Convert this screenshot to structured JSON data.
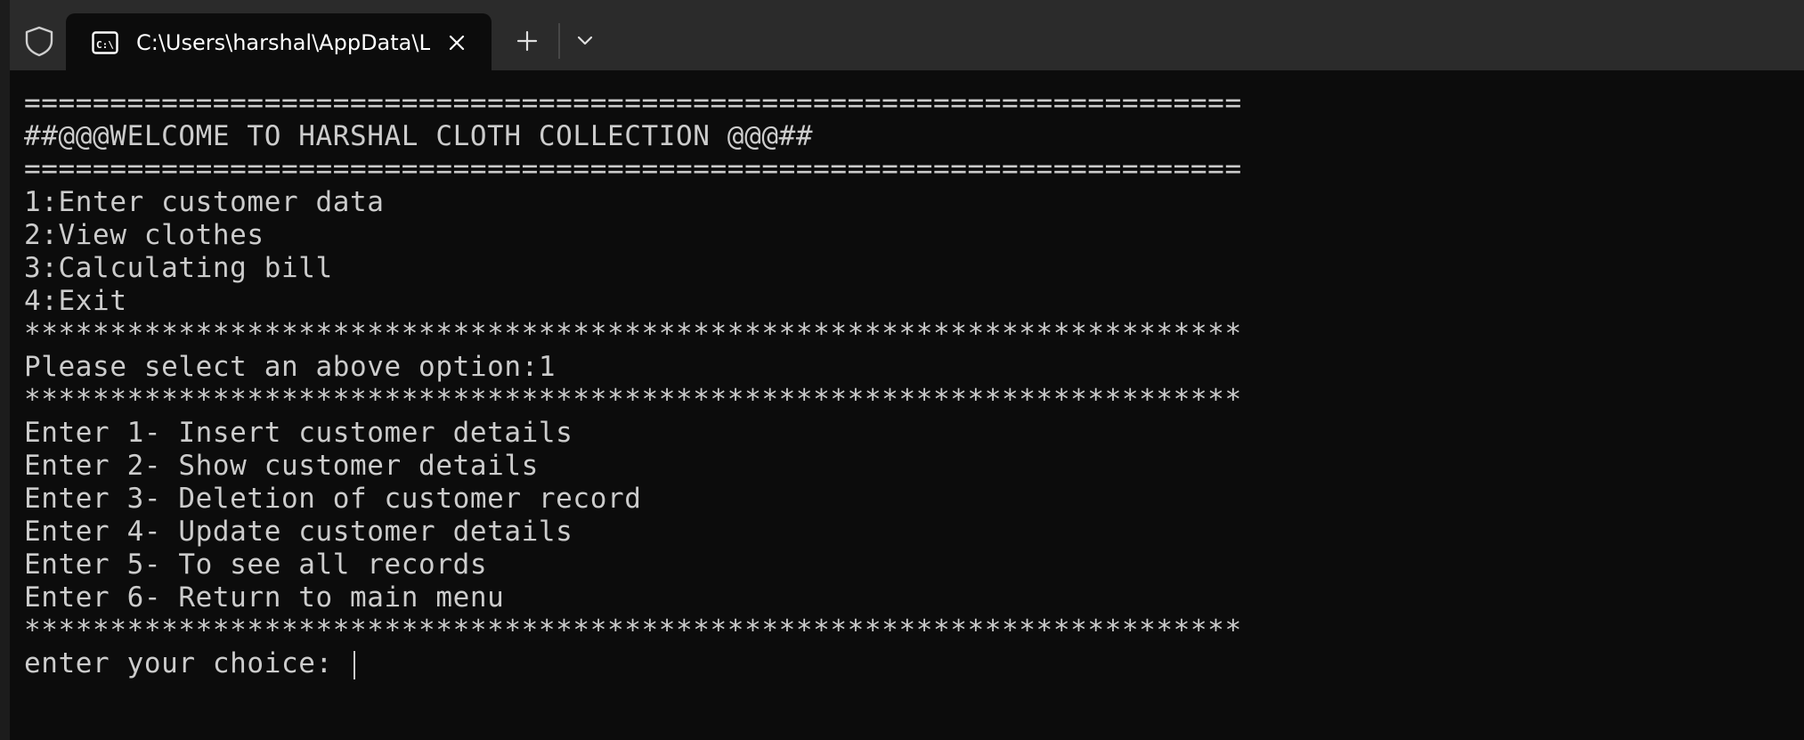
{
  "window": {
    "tab_title": "C:\\Users\\harshal\\AppData\\Local\\Temp\\",
    "icons": {
      "shield": "shield-icon",
      "tab": "command-prompt-icon",
      "close": "close-icon",
      "new_tab": "plus-icon",
      "dropdown": "chevron-down-icon"
    }
  },
  "terminal": {
    "lines": [
      "=======================================================================",
      "##@@@WELCOME TO HARSHAL CLOTH COLLECTION @@@##",
      "=======================================================================",
      "1:Enter customer data",
      "2:View clothes",
      "3:Calculating bill",
      "4:Exit",
      "***********************************************************************",
      "Please select an above option:1",
      "***********************************************************************",
      "Enter 1- Insert customer details",
      "Enter 2- Show customer details",
      "Enter 3- Deletion of customer record",
      "Enter 4- Update customer details",
      "Enter 5- To see all records",
      "Enter 6- Return to main menu",
      "***********************************************************************"
    ],
    "prompt": "enter your choice: "
  },
  "colors": {
    "background": "#0c0c0c",
    "titlebar": "#2b2b2b",
    "text": "#cccccc"
  }
}
